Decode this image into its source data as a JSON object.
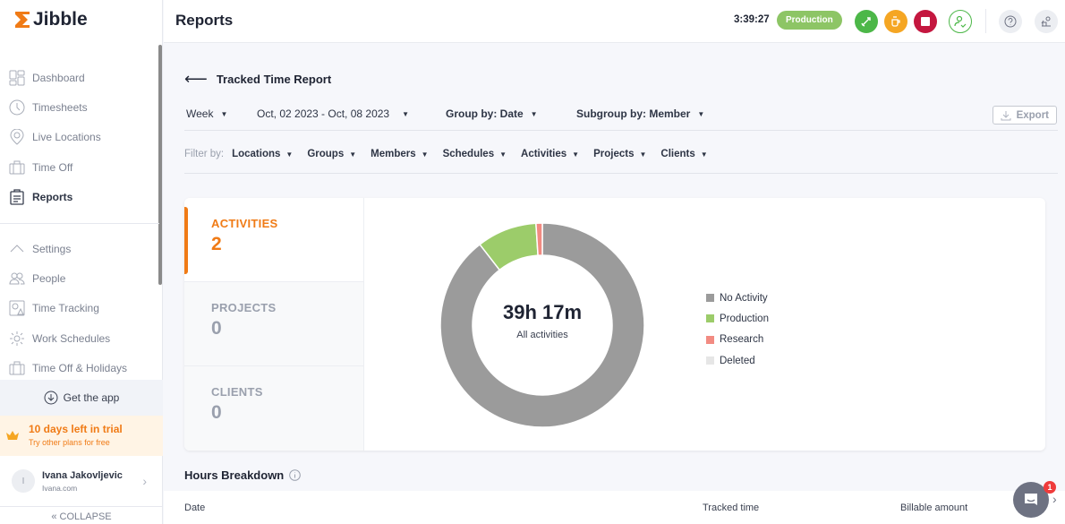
{
  "app": {
    "name": "Jibble",
    "brand_color": "#f07b16"
  },
  "sidebar": {
    "items": [
      {
        "label": "Dashboard",
        "icon": "dashboard-icon",
        "active": false
      },
      {
        "label": "Timesheets",
        "icon": "clock-icon",
        "active": false
      },
      {
        "label": "Live Locations",
        "icon": "location-pin-icon",
        "active": false
      },
      {
        "label": "Time Off",
        "icon": "suitcase-icon",
        "active": false
      },
      {
        "label": "Reports",
        "icon": "clipboard-icon",
        "active": true
      }
    ],
    "settings_items": [
      {
        "label": "Settings",
        "icon": "chevron-up-icon"
      },
      {
        "label": "People",
        "icon": "people-icon"
      },
      {
        "label": "Time Tracking",
        "icon": "time-tracking-icon"
      },
      {
        "label": "Work Schedules",
        "icon": "schedule-icon"
      },
      {
        "label": "Time Off & Holidays",
        "icon": "suitcase-icon"
      }
    ],
    "get_app": "Get the app",
    "trial": {
      "title": "10 days left in trial",
      "subtitle": "Try other plans for free"
    },
    "user": {
      "initial": "I",
      "name": "Ivana Jakovljevic",
      "email": "Ivana.com"
    },
    "collapse": "COLLAPSE"
  },
  "header": {
    "title": "Reports",
    "timer": "3:39:27",
    "activity_badge": "Production"
  },
  "report": {
    "title": "Tracked Time Report",
    "period": "Week",
    "date_range": "Oct, 02 2023 - Oct, 08 2023",
    "group_by": "Group by: Date",
    "subgroup_by": "Subgroup by: Member",
    "export": "Export",
    "filter_label": "Filter by:",
    "filters": [
      "Locations",
      "Groups",
      "Members",
      "Schedules",
      "Activities",
      "Projects",
      "Clients"
    ]
  },
  "summary_tabs": [
    {
      "label": "ACTIVITIES",
      "value": "2",
      "active": true
    },
    {
      "label": "PROJECTS",
      "value": "0",
      "active": false
    },
    {
      "label": "CLIENTS",
      "value": "0",
      "active": false
    }
  ],
  "chart_data": {
    "type": "pie",
    "variant": "donut",
    "center_value": "39h 17m",
    "center_label": "All activities",
    "slices": [
      {
        "name": "No Activity",
        "value": 89.5,
        "color": "#9b9b9b"
      },
      {
        "name": "Production",
        "value": 9.5,
        "color": "#9ccc6a"
      },
      {
        "name": "Research",
        "value": 1.0,
        "color": "#f28b82"
      },
      {
        "name": "Deleted",
        "value": 0,
        "color": "#e6e6e6"
      }
    ],
    "unit": "percent of tracked time (estimated)",
    "legend_position": "right"
  },
  "breakdown": {
    "title": "Hours Breakdown",
    "columns": [
      "Date",
      "Tracked time",
      "Billable amount"
    ]
  },
  "chat": {
    "badge": "1"
  }
}
